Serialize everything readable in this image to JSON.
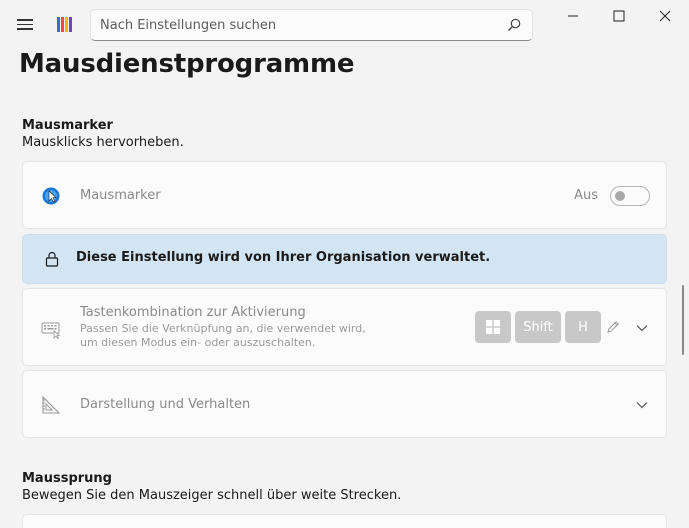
{
  "search": {
    "placeholder": "Nach Einstellungen suchen"
  },
  "page": {
    "title": "Mausdienstprogramme"
  },
  "sections": {
    "mausmarker": {
      "title": "Mausmarker",
      "description": "Mausklicks hervorheben."
    },
    "mausspurung": {
      "title": "Maussprung",
      "description": "Bewegen Sie den Mauszeiger schnell über weite Strecken."
    }
  },
  "cards": {
    "mausmarker": {
      "label": "Mausmarker",
      "toggle_state": "Aus",
      "enabled": false
    },
    "banner": {
      "text": "Diese Einstellung wird von Ihrer Organisation verwaltet."
    },
    "shortcut": {
      "label": "Tastenkombination zur Aktivierung",
      "sub1": "Passen Sie die Verknüpfung an, die verwendet wird,",
      "sub2": "um diesen Modus ein- oder auszuschalten.",
      "keys": [
        "Shift",
        "H"
      ]
    },
    "appearance": {
      "label": "Darstellung und Verhalten"
    }
  },
  "colors": {
    "background": "#f3f3f3",
    "card": "#fbfbfb",
    "banner": "#d3e4f3",
    "disabled_text": "#8a8a8a",
    "keycap": "#c8c8c8"
  },
  "icons": {
    "menu": "hamburger-icon",
    "app": "powertoys-logo",
    "search": "search-icon",
    "mausmarker": "mouse-highlighter-icon",
    "lock": "lock-icon",
    "keyboard": "keyboard-icon",
    "appearance": "ruler-triangle-icon",
    "windows": "windows-key-icon",
    "edit": "pencil-icon",
    "expand": "chevron-down-icon"
  }
}
